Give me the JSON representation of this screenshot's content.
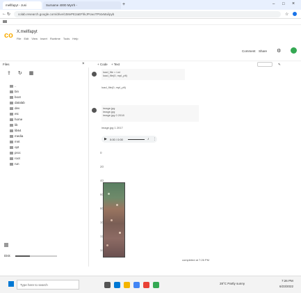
{
  "browser": {
    "tabs": [
      {
        "label": "mellfapyt - Jusi"
      },
      {
        "label": "Surname 4000 Myrrh -"
      }
    ],
    "url": "colab.research.google.com/drive/1tMvPE2aEFhkJPcwoTPt4xMa/ipyb",
    "accent": "#1a73e8"
  },
  "app": {
    "notebook_title": "X.mellfapyt",
    "menu_items": [
      "File",
      "Edit",
      "View",
      "Insert",
      "Runtime",
      "Tools",
      "Help"
    ],
    "header_actions": {
      "comment": "Comment",
      "share": "Share"
    },
    "code_btn": "+ Code",
    "text_btn": "+ Text"
  },
  "sidebar": {
    "title": "Files",
    "items": [
      {
        "label": ".."
      },
      {
        "label": "bin"
      },
      {
        "label": "boot"
      },
      {
        "label": "datalab"
      },
      {
        "label": "dev"
      },
      {
        "label": "etc"
      },
      {
        "label": "home"
      },
      {
        "label": "lib"
      },
      {
        "label": "lib64"
      },
      {
        "label": "media"
      },
      {
        "label": "mnt"
      },
      {
        "label": "opt"
      },
      {
        "label": "proc"
      },
      {
        "label": "root"
      },
      {
        "label": "run"
      }
    ],
    "disk_label": "Disk"
  },
  "cells": {
    "cell1_lines": [
      "load_file = Lst",
      "load_file(0, mpl_plt)"
    ],
    "cell1_output": "load_file(0, mpl_plt)",
    "cell2_lines": [
      "image.jpg",
      "image.jpg",
      "image.jpg 0 2018"
    ],
    "cell2_output": "image.jpg 1 2017",
    "audio_time": "0:00 / 0:00",
    "status": "completed at 7:26 PM"
  },
  "taskbar": {
    "search_placeholder": "Type here to search",
    "weather": "28°C Partly sunny",
    "time": "7:26 PM",
    "date": "6/23/2022"
  }
}
